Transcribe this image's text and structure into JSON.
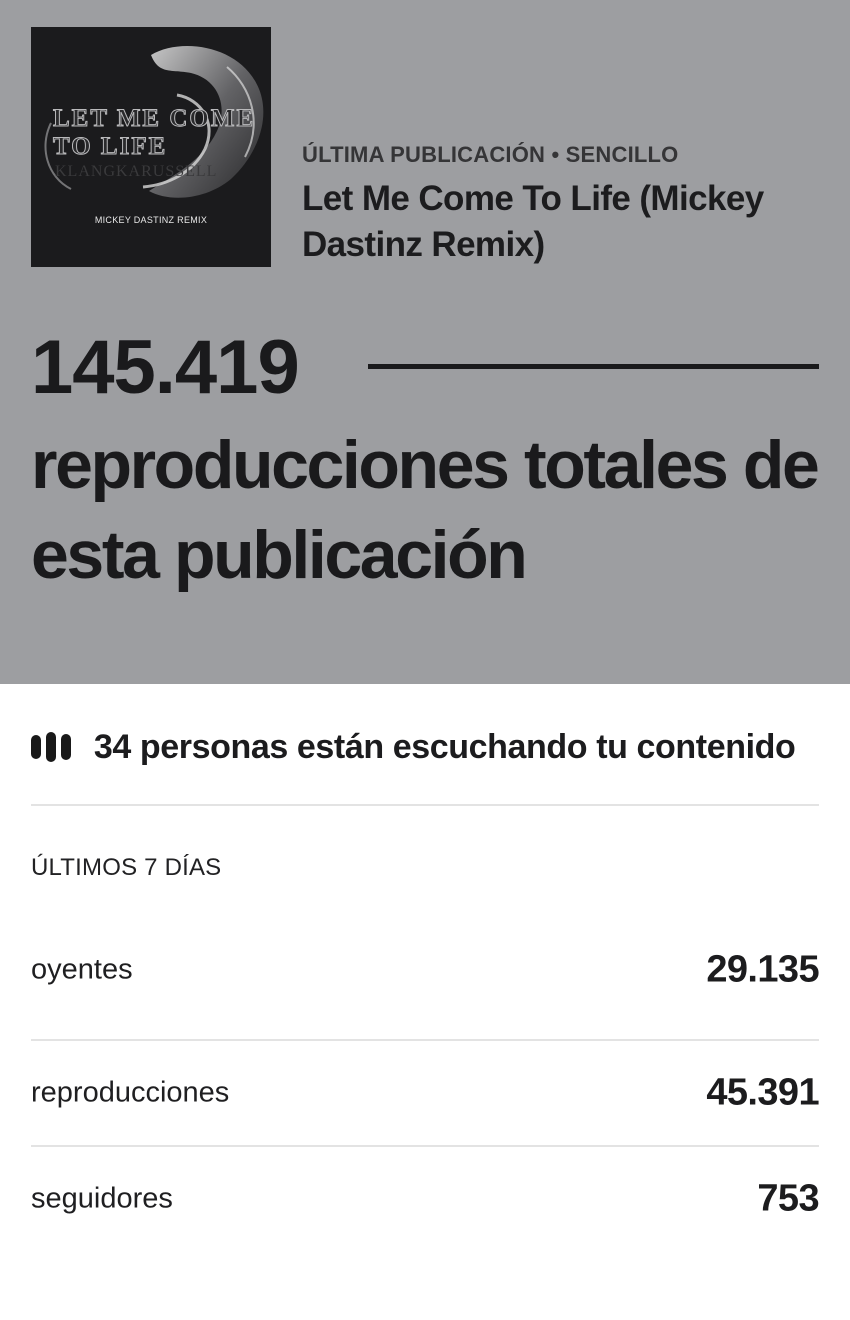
{
  "release": {
    "cover": {
      "title_text": "LET ME COME TO LIFE",
      "artist_text": "KLANGKARUSSELL",
      "subtitle_text": "MICKEY DASTINZ REMIX"
    },
    "meta": "ÚLTIMA PUBLICACIÓN • SENCILLO",
    "title": "Let Me Come To Life (Mickey Dastinz Remix)"
  },
  "totals": {
    "count": "145.419",
    "label": "reproducciones totales de esta publicación"
  },
  "live": {
    "icon": "live-bars-icon",
    "text": "34 personas están escuchando tu contenido"
  },
  "stats": {
    "period": "ÚLTIMOS 7 DÍAS",
    "listeners": {
      "label": "oyentes",
      "value": "29.135"
    },
    "streams": {
      "label": "reproducciones",
      "value": "45.391"
    },
    "followers": {
      "label": "seguidores",
      "value": "753"
    }
  },
  "colors": {
    "hero_background": "#9d9ea1",
    "text": "#1a1a1c",
    "divider": "#e3e3e3"
  }
}
